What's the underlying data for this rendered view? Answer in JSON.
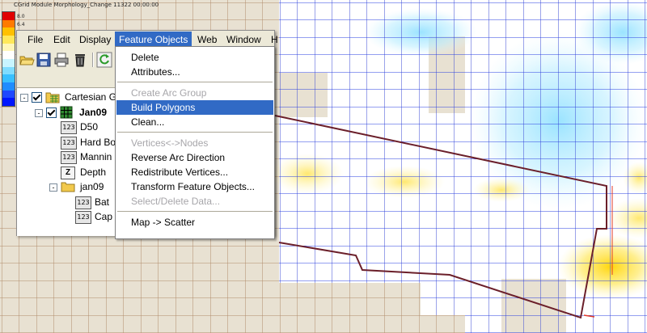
{
  "window_title": "CGrid Module Morphology_Change 11322 00:00:00",
  "legend": {
    "values": [
      "8.0",
      "6.4"
    ],
    "colors": [
      "#e00000",
      "#ff7a00",
      "#ffc000",
      "#ffe85a",
      "#fff6b8",
      "#ffffff",
      "#c8f4ff",
      "#7fdcff",
      "#38bfff",
      "#1f8cff",
      "#1f48ff",
      "#0016ff"
    ]
  },
  "menubar": {
    "items": [
      "File",
      "Edit",
      "Display",
      "Feature Objects",
      "Web",
      "Window",
      "H"
    ],
    "active": "Feature Objects"
  },
  "toolbar": {
    "icons": [
      "open-icon",
      "save-icon",
      "print-icon",
      "delete-icon",
      "refresh-icon"
    ]
  },
  "tree": {
    "items": [
      {
        "label": "Cartesian Gr",
        "icon": "grid-folder-icon",
        "level": 0,
        "checked": true,
        "expander": "-"
      },
      {
        "label": "Jan09",
        "icon": "grid-icon",
        "level": 1,
        "checked": true,
        "bold": true,
        "expander": "-"
      },
      {
        "label": "D50",
        "icon": "123",
        "level": 2
      },
      {
        "label": "Hard Bo",
        "icon": "123",
        "level": 2
      },
      {
        "label": "Mannin",
        "icon": "123",
        "level": 2
      },
      {
        "label": "Depth",
        "icon": "Z",
        "level": 2
      },
      {
        "label": "jan09",
        "icon": "folder-icon",
        "level": 2,
        "expander": "-"
      },
      {
        "label": "Bat",
        "icon": "123",
        "level": 3
      },
      {
        "label": "Cap",
        "icon": "123",
        "level": 3
      }
    ]
  },
  "dropdown": {
    "items": [
      {
        "label": "Delete",
        "state": "enabled"
      },
      {
        "label": "Attributes...",
        "state": "enabled"
      },
      {
        "sep": true
      },
      {
        "label": "Create Arc Group",
        "state": "disabled"
      },
      {
        "label": "Build Polygons",
        "state": "highlighted"
      },
      {
        "label": "Clean...",
        "state": "enabled"
      },
      {
        "sep": true
      },
      {
        "label": "Vertices<->Nodes",
        "state": "disabled"
      },
      {
        "label": "Reverse Arc Direction",
        "state": "enabled"
      },
      {
        "label": "Redistribute Vertices...",
        "state": "enabled"
      },
      {
        "label": "Transform Feature Objects...",
        "state": "enabled"
      },
      {
        "label": "Select/Delete Data...",
        "state": "disabled"
      },
      {
        "sep": true
      },
      {
        "label": "Map -> Scatter",
        "state": "enabled"
      }
    ]
  },
  "colors": {
    "grid_line_blue": "#2a3fe0",
    "grid_line_tan": "#b08a6a",
    "land": "#e8e1d2",
    "polygon_outline": "#6b1f2a",
    "highlight": "#316ac5"
  }
}
